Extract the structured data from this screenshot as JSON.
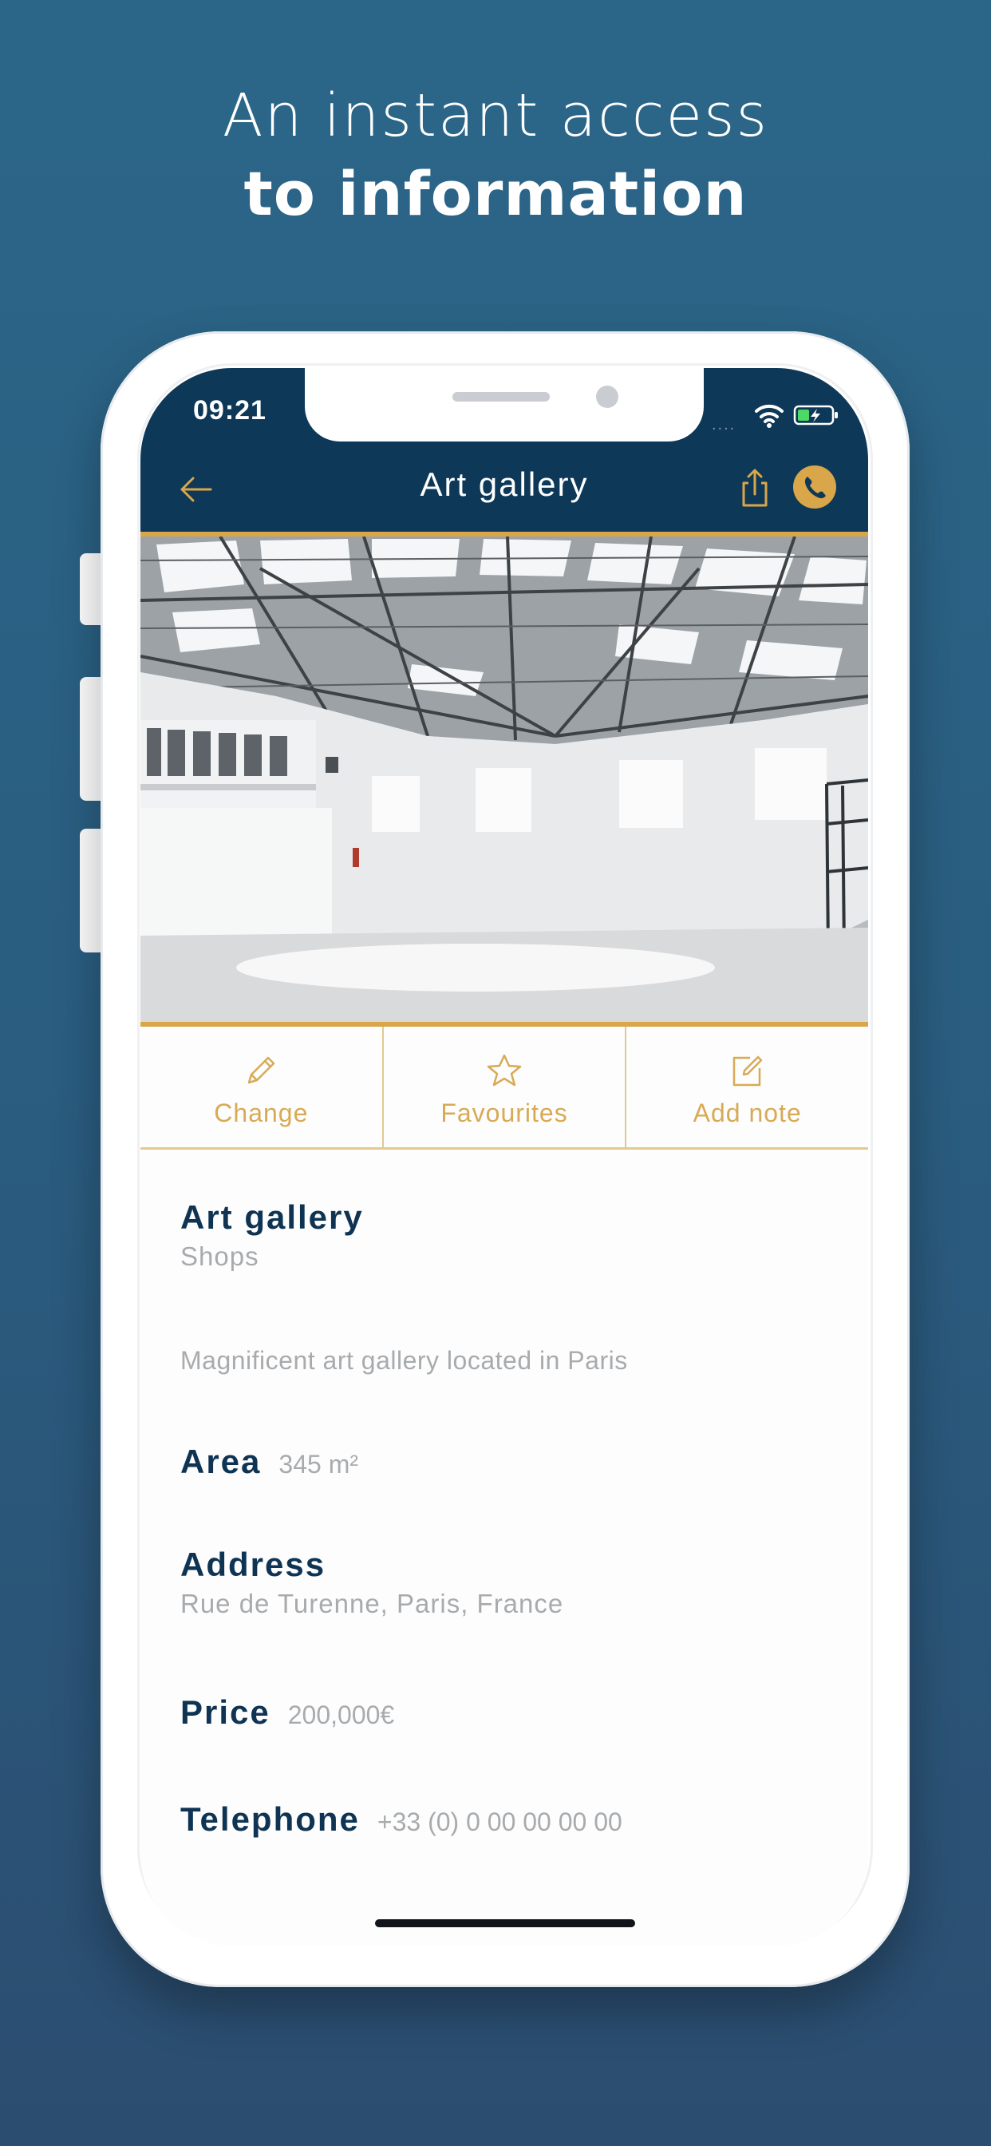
{
  "headline": {
    "line1": "An instant access",
    "line2": "to information"
  },
  "status_bar": {
    "time": "09:21",
    "signal": "....",
    "icons": [
      "wifi-icon",
      "battery-charging-icon"
    ]
  },
  "nav": {
    "title": "Art gallery",
    "icons": [
      "arrow-left-icon",
      "share-icon",
      "phone-icon"
    ]
  },
  "actions": [
    {
      "label": "Change",
      "icon": "pencil-icon"
    },
    {
      "label": "Favourites",
      "icon": "star-icon"
    },
    {
      "label": "Add note",
      "icon": "edit-note-icon"
    }
  ],
  "listing": {
    "title": "Art gallery",
    "category": "Shops",
    "description": "Magnificent art gallery located in Paris",
    "area_label": "Area",
    "area_value": "345 m²",
    "address_label": "Address",
    "address_value": "Rue de Turenne, Paris, France",
    "price_label": "Price",
    "price_value": "200,000€",
    "telephone_label": "Telephone",
    "telephone_value": "+33 (0) 0 00 00 00 00"
  },
  "colors": {
    "background": "#2b6688",
    "navbar": "#0e3858",
    "accent_gold": "#d9a64a",
    "text_dark": "#0f3453",
    "text_muted": "#a8abae"
  }
}
